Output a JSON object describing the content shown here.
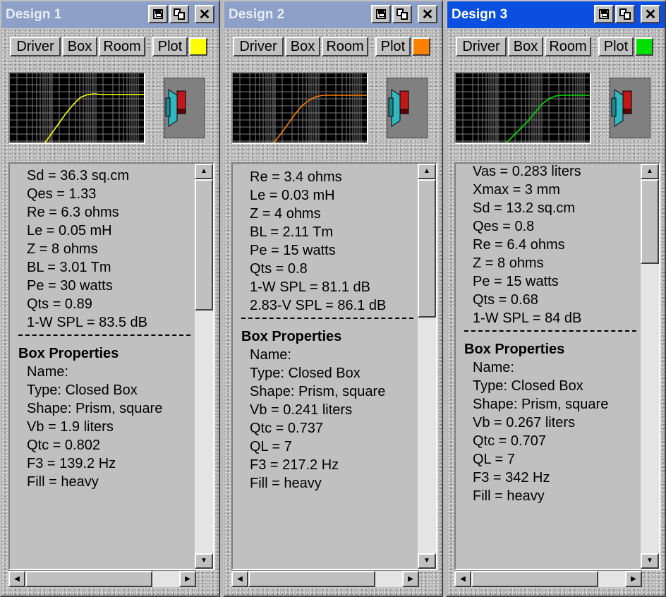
{
  "toolbar": {
    "driver": "Driver",
    "box": "Box",
    "room": "Room",
    "plot": "Plot"
  },
  "windows": [
    {
      "title": "Design 1",
      "active": false,
      "plot_color": "#ffff00",
      "driver_lines": [
        "Sd =  36.3 sq.cm",
        "Qes =  1.33",
        "Re =  6.3 ohms",
        "Le =  0.05 mH",
        "Z =  8 ohms",
        "BL =  3.01 Tm",
        "Pe =  30 watts",
        "Qts =  0.89",
        "1-W SPL =  83.5 dB"
      ],
      "box_heading": "Box Properties",
      "box_lines": [
        "Name:",
        "Type: Closed Box",
        "Shape: Prism, square",
        "Vb =  1.9 liters",
        "Qtc =  0.802",
        "F3 =  139.2 Hz",
        "Fill = heavy"
      ]
    },
    {
      "title": "Design 2",
      "active": false,
      "plot_color": "#ff8000",
      "driver_lines": [
        "Re =  3.4 ohms",
        "Le =  0.03 mH",
        "Z =  4 ohms",
        "BL =  2.11 Tm",
        "Pe =  15 watts",
        "Qts =  0.8",
        "1-W SPL =  81.1 dB",
        "2.83-V SPL =  86.1 dB"
      ],
      "box_heading": "Box Properties",
      "box_lines": [
        "Name:",
        "Type: Closed Box",
        "Shape: Prism, square",
        "Vb =  0.241 liters",
        "Qtc =  0.737",
        "QL =  7",
        "F3 =  217.2 Hz",
        "Fill = heavy"
      ]
    },
    {
      "title": "Design 3",
      "active": true,
      "plot_color": "#00e000",
      "driver_lines": [
        "Vas =  0.283 liters",
        "Xmax =  3 mm",
        "Sd =  13.2 sq.cm",
        "Qes =  0.8",
        "Re =  6.4 ohms",
        "Z =  8 ohms",
        "Pe =  15 watts",
        "Qts =  0.68",
        "1-W SPL =  84 dB"
      ],
      "box_heading": "Box Properties",
      "box_lines": [
        "Name:",
        "Type: Closed Box",
        "Shape: Prism, square",
        "Vb =  0.267 liters",
        "Qtc =  0.707",
        "QL =  7",
        "F3 =  342 Hz",
        "Fill = heavy"
      ]
    }
  ]
}
